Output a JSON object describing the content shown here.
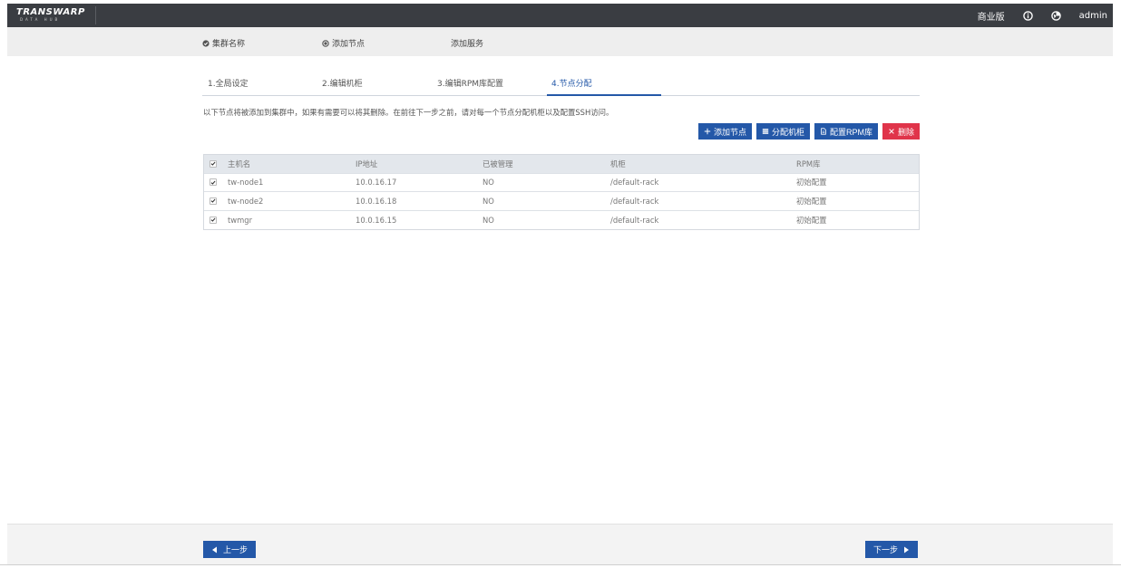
{
  "app": {
    "logo_text": "TRANSWARP",
    "logo_sub": "DATA HUB",
    "edition": "商业版",
    "user": "admin"
  },
  "steps": [
    {
      "label": "集群名称",
      "icon": "check-circle-icon"
    },
    {
      "label": "添加节点",
      "icon": "dot-circle-icon"
    },
    {
      "label": "添加服务",
      "icon": ""
    }
  ],
  "tabs": [
    {
      "label": "1.全局设定"
    },
    {
      "label": "2.编辑机柜"
    },
    {
      "label": "3.编辑RPM库配置"
    },
    {
      "label": "4.节点分配",
      "active": true
    }
  ],
  "description": "以下节点将被添加到集群中，如果有需要可以将其删除。在前往下一步之前，请对每一个节点分配机柜以及配置SSH访问。",
  "actions": {
    "add_node": "添加节点",
    "assign_rack": "分配机柜",
    "config_rpm": "配置RPM库",
    "delete": "删除"
  },
  "table": {
    "headers": [
      "主机名",
      "IP地址",
      "已被管理",
      "机柜",
      "RPM库"
    ],
    "rows": [
      {
        "hostname": "tw-node1",
        "ip": "10.0.16.17",
        "managed": "NO",
        "rack": "/default-rack",
        "rpm": "初始配置",
        "checked": true
      },
      {
        "hostname": "tw-node2",
        "ip": "10.0.16.18",
        "managed": "NO",
        "rack": "/default-rack",
        "rpm": "初始配置",
        "checked": true
      },
      {
        "hostname": "twmgr",
        "ip": "10.0.16.15",
        "managed": "NO",
        "rack": "/default-rack",
        "rpm": "初始配置",
        "checked": true
      }
    ]
  },
  "footer": {
    "prev": "上一步",
    "next": "下一步"
  },
  "colors": {
    "topbar": "#3a3d42",
    "primary": "#2458a8",
    "danger": "#e0344a"
  }
}
